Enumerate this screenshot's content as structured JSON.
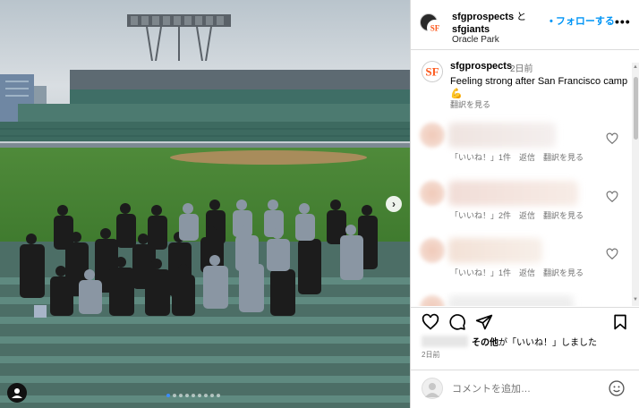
{
  "post": {
    "author1": "sfgprospects",
    "conjunction": "と",
    "author2": "sfgiants",
    "location": "Oracle Park",
    "follow_label": "フォローする",
    "more_label": "•••"
  },
  "caption": {
    "username": "sfgprospects",
    "time": "2日前",
    "text": "Feeling strong after San Francisco camp",
    "emoji": "💪",
    "translate": "翻訳を見る"
  },
  "comments": [
    {
      "likes": "「いいね！」1件",
      "reply": "返信",
      "translate": "翻訳を見る"
    },
    {
      "likes": "「いいね！」2件",
      "reply": "返信",
      "translate": "翻訳を見る"
    },
    {
      "likes": "「いいね！」1件",
      "reply": "返信",
      "translate": "翻訳を見る"
    }
  ],
  "likes_line": {
    "others": "その他",
    "suffix": "が「いいね！」しました"
  },
  "date": "2日前",
  "add_comment": {
    "placeholder": "コメントを追加…"
  },
  "carousel": {
    "dot_count": 9,
    "active_index": 0
  },
  "icons": [
    "heart-icon",
    "comment-icon",
    "share-icon",
    "bookmark-icon",
    "emoji-icon",
    "chevron-right-icon",
    "user-tag-icon"
  ],
  "colors": {
    "link_blue": "#0095f6",
    "giants_orange": "#fd5a1e",
    "text_gray": "#737373"
  }
}
